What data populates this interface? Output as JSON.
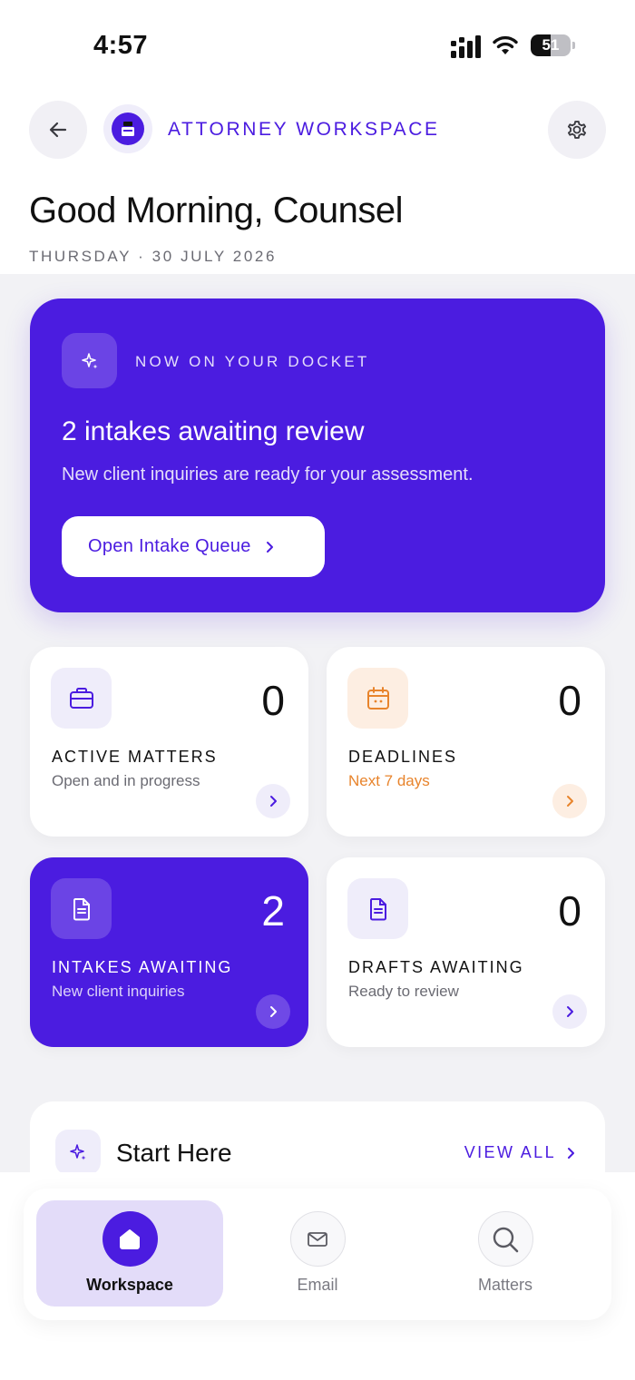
{
  "status_bar": {
    "time": "4:57",
    "battery": "51",
    "battery_level": 0.51
  },
  "header": {
    "title": "ATTORNEY WORKSPACE",
    "greeting": "Good Morning, Counsel",
    "date": "THURSDAY · 30 JULY 2026"
  },
  "hero": {
    "kicker": "NOW ON YOUR DOCKET",
    "title": "2 intakes awaiting review",
    "subtitle": "New client inquiries are ready for your assessment.",
    "button_label": "Open Intake Queue"
  },
  "stats": [
    {
      "label": "ACTIVE MATTERS",
      "sub": "Open and in progress",
      "value": "0"
    },
    {
      "label": "DEADLINES",
      "sub": "Next 7 days",
      "value": "0"
    },
    {
      "label": "INTAKES AWAITING",
      "sub": "New client inquiries",
      "value": "2"
    },
    {
      "label": "DRAFTS AWAITING",
      "sub": "Ready to review",
      "value": "0"
    }
  ],
  "start_here": {
    "title": "Start Here",
    "view_all": "VIEW ALL"
  },
  "nav": {
    "items": [
      {
        "label": "Workspace",
        "icon": "home-icon",
        "active": true
      },
      {
        "label": "Email",
        "icon": "mail-icon",
        "active": false
      },
      {
        "label": "Matters",
        "icon": "search-icon",
        "active": false
      }
    ]
  },
  "colors": {
    "accent": "#4b1ce0",
    "accent_light": "#efedfa",
    "warning": "#e8842c",
    "warning_light": "#fdeee2",
    "background": "#f2f2f5"
  }
}
